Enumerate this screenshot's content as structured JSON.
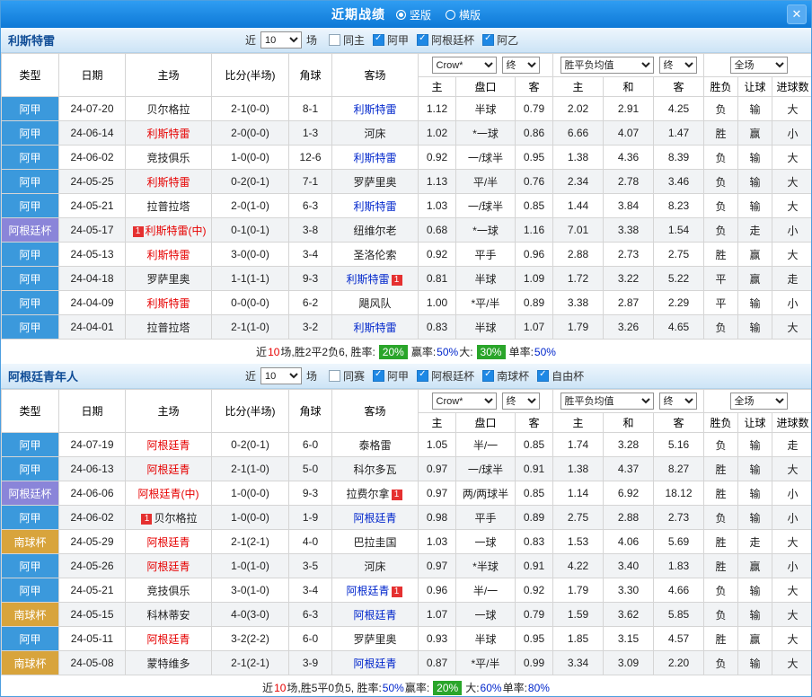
{
  "topbar": {
    "title": "近期战绩",
    "radios": [
      {
        "label": "竖版",
        "selected": true
      },
      {
        "label": "横版",
        "selected": false
      }
    ],
    "close_icon": "✕"
  },
  "header_labels": {
    "type": "类型",
    "date": "日期",
    "home": "主场",
    "score": "比分(半场)",
    "corner": "角球",
    "away": "客场",
    "odds_home": "主",
    "handicap": "盘口",
    "odds_away": "客",
    "eu_home": "主",
    "eu_draw": "和",
    "eu_away": "客",
    "result": "胜负",
    "handicap_result": "让球",
    "goals": "进球数",
    "bookmaker": "Crow*",
    "final": "终",
    "eu_avg": "胜平负均值",
    "scope": "全场",
    "recent_pre": "近",
    "recent_post": "场"
  },
  "red_card_badge": "1",
  "league_colors": {
    "阿甲": "#3b99dc",
    "阿根廷杯": "#8a85d9",
    "南球杯": "#d8a43c"
  },
  "value_colors": {
    "胜": "red",
    "平": "blue",
    "负": "green",
    "赢": "red",
    "走": "blue",
    "输": "green",
    "大": "red",
    "小": "green"
  },
  "accent_colors": {
    "win_red": "#e60000",
    "draw_blue": "#0026cc",
    "lose_green": "#009933",
    "badge_green": "#2aa52a",
    "bar_blue": "#1d8ae0"
  },
  "sections": [
    {
      "team": "利斯特雷",
      "recent_value": "10",
      "checkboxes": [
        {
          "label": "同主",
          "checked": false
        },
        {
          "label": "阿甲",
          "checked": true
        },
        {
          "label": "阿根廷杯",
          "checked": true
        },
        {
          "label": "阿乙",
          "checked": true
        }
      ],
      "rows": [
        {
          "lg": "阿甲",
          "dt": "24-07-20",
          "hm": "贝尔格拉",
          "hc": "blk",
          "hb": "",
          "sc": "2-1(0-0)",
          "scc": "red",
          "cn": "8-1",
          "aw": "利斯特雷",
          "ac": "blue",
          "ab": "",
          "o1": "1.12",
          "hd": "半球",
          "o2": "0.79",
          "e1": "2.02",
          "e2": "2.91",
          "e3": "4.25",
          "rs": "负",
          "hr": "输",
          "gl": "大"
        },
        {
          "lg": "阿甲",
          "dt": "24-06-14",
          "hm": "利斯特雷",
          "hc": "red",
          "hb": "",
          "sc": "2-0(0-0)",
          "scc": "red",
          "cn": "1-3",
          "aw": "河床",
          "ac": "blk",
          "ab": "",
          "o1": "1.02",
          "hd": "*一球",
          "o2": "0.86",
          "e1": "6.66",
          "e2": "4.07",
          "e3": "1.47",
          "rs": "胜",
          "hr": "赢",
          "gl": "小"
        },
        {
          "lg": "阿甲",
          "dt": "24-06-02",
          "hm": "竞技俱乐",
          "hc": "blk",
          "hb": "",
          "sc": "1-0(0-0)",
          "scc": "red",
          "cn": "12-6",
          "aw": "利斯特雷",
          "ac": "blue",
          "ab": "",
          "o1": "0.92",
          "hd": "一/球半",
          "o2": "0.95",
          "e1": "1.38",
          "e2": "4.36",
          "e3": "8.39",
          "rs": "负",
          "hr": "输",
          "gl": "大"
        },
        {
          "lg": "阿甲",
          "dt": "24-05-25",
          "hm": "利斯特雷",
          "hc": "red",
          "hb": "",
          "sc": "0-2(0-1)",
          "scc": "blue",
          "cn": "7-1",
          "aw": "罗萨里奥",
          "ac": "blk",
          "ab": "",
          "o1": "1.13",
          "hd": "平/半",
          "o2": "0.76",
          "e1": "2.34",
          "e2": "2.78",
          "e3": "3.46",
          "rs": "负",
          "hr": "输",
          "gl": "大"
        },
        {
          "lg": "阿甲",
          "dt": "24-05-21",
          "hm": "拉普拉塔",
          "hc": "blk",
          "hb": "",
          "sc": "2-0(1-0)",
          "scc": "red",
          "cn": "6-3",
          "aw": "利斯特雷",
          "ac": "blue",
          "ab": "",
          "o1": "1.03",
          "hd": "一/球半",
          "o2": "0.85",
          "e1": "1.44",
          "e2": "3.84",
          "e3": "8.23",
          "rs": "负",
          "hr": "输",
          "gl": "大"
        },
        {
          "lg": "阿根廷杯",
          "dt": "24-05-17",
          "hm": "利斯特雷(中)",
          "hc": "red",
          "hb": "pre",
          "sc": "0-1(0-1)",
          "scc": "blue",
          "cn": "3-8",
          "aw": "纽维尔老",
          "ac": "blk",
          "ab": "",
          "o1": "0.68",
          "hd": "*一球",
          "o2": "1.16",
          "e1": "7.01",
          "e2": "3.38",
          "e3": "1.54",
          "rs": "负",
          "hr": "走",
          "gl": "小"
        },
        {
          "lg": "阿甲",
          "dt": "24-05-13",
          "hm": "利斯特雷",
          "hc": "red",
          "hb": "",
          "sc": "3-0(0-0)",
          "scc": "red",
          "cn": "3-4",
          "aw": "圣洛伦索",
          "ac": "blk",
          "ab": "",
          "o1": "0.92",
          "hd": "平手",
          "o2": "0.96",
          "e1": "2.88",
          "e2": "2.73",
          "e3": "2.75",
          "rs": "胜",
          "hr": "赢",
          "gl": "大"
        },
        {
          "lg": "阿甲",
          "dt": "24-04-18",
          "hm": "罗萨里奥",
          "hc": "blk",
          "hb": "",
          "sc": "1-1(1-1)",
          "scc": "green",
          "cn": "9-3",
          "aw": "利斯特雷",
          "ac": "blue",
          "ab": "post",
          "o1": "0.81",
          "hd": "半球",
          "o2": "1.09",
          "e1": "1.72",
          "e2": "3.22",
          "e3": "5.22",
          "rs": "平",
          "hr": "赢",
          "gl": "走"
        },
        {
          "lg": "阿甲",
          "dt": "24-04-09",
          "hm": "利斯特雷",
          "hc": "red",
          "hb": "",
          "sc": "0-0(0-0)",
          "scc": "green",
          "cn": "6-2",
          "aw": "飓风队",
          "ac": "blk",
          "ab": "",
          "o1": "1.00",
          "hd": "*平/半",
          "o2": "0.89",
          "e1": "3.38",
          "e2": "2.87",
          "e3": "2.29",
          "rs": "平",
          "hr": "输",
          "gl": "小"
        },
        {
          "lg": "阿甲",
          "dt": "24-04-01",
          "hm": "拉普拉塔",
          "hc": "blk",
          "hb": "",
          "sc": "2-1(1-0)",
          "scc": "red",
          "cn": "3-2",
          "aw": "利斯特雷",
          "ac": "blue",
          "ab": "",
          "o1": "0.83",
          "hd": "半球",
          "o2": "1.07",
          "e1": "1.79",
          "e2": "3.26",
          "e3": "4.65",
          "rs": "负",
          "hr": "输",
          "gl": "大"
        }
      ],
      "summary": [
        {
          "t": "近",
          "s": ""
        },
        {
          "t": "10",
          "s": "red"
        },
        {
          "t": "场,胜2平2负6, 胜率:",
          "s": ""
        },
        {
          "t": "20%",
          "s": "badge"
        },
        {
          "t": " 赢率:",
          "s": ""
        },
        {
          "t": "50%",
          "s": "blue"
        },
        {
          "t": " 大:",
          "s": ""
        },
        {
          "t": "30%",
          "s": "badge"
        },
        {
          "t": " 单率:",
          "s": ""
        },
        {
          "t": "50%",
          "s": "blue"
        }
      ]
    },
    {
      "team": "阿根廷青年人",
      "recent_value": "10",
      "checkboxes": [
        {
          "label": "同赛",
          "checked": false
        },
        {
          "label": "阿甲",
          "checked": true
        },
        {
          "label": "阿根廷杯",
          "checked": true
        },
        {
          "label": "南球杯",
          "checked": true
        },
        {
          "label": "自由杯",
          "checked": true
        }
      ],
      "rows": [
        {
          "lg": "阿甲",
          "dt": "24-07-19",
          "hm": "阿根廷青",
          "hc": "red",
          "hb": "",
          "sc": "0-2(0-1)",
          "scc": "blue",
          "cn": "6-0",
          "aw": "泰格雷",
          "ac": "blk",
          "ab": "",
          "o1": "1.05",
          "hd": "半/一",
          "o2": "0.85",
          "e1": "1.74",
          "e2": "3.28",
          "e3": "5.16",
          "rs": "负",
          "hr": "输",
          "gl": "走"
        },
        {
          "lg": "阿甲",
          "dt": "24-06-13",
          "hm": "阿根廷青",
          "hc": "red",
          "hb": "",
          "sc": "2-1(1-0)",
          "scc": "red",
          "cn": "5-0",
          "aw": "科尔多瓦",
          "ac": "blk",
          "ab": "",
          "o1": "0.97",
          "hd": "一/球半",
          "o2": "0.91",
          "e1": "1.38",
          "e2": "4.37",
          "e3": "8.27",
          "rs": "胜",
          "hr": "输",
          "gl": "大"
        },
        {
          "lg": "阿根廷杯",
          "dt": "24-06-06",
          "hm": "阿根廷青(中)",
          "hc": "red",
          "hb": "",
          "sc": "1-0(0-0)",
          "scc": "red",
          "cn": "9-3",
          "aw": "拉费尔拿",
          "ac": "blk",
          "ab": "post",
          "o1": "0.97",
          "hd": "两/两球半",
          "o2": "0.85",
          "e1": "1.14",
          "e2": "6.92",
          "e3": "18.12",
          "rs": "胜",
          "hr": "输",
          "gl": "小"
        },
        {
          "lg": "阿甲",
          "dt": "24-06-02",
          "hm": "贝尔格拉",
          "hc": "blk",
          "hb": "pre",
          "sc": "1-0(0-0)",
          "scc": "red",
          "cn": "1-9",
          "aw": "阿根廷青",
          "ac": "blue",
          "ab": "",
          "o1": "0.98",
          "hd": "平手",
          "o2": "0.89",
          "e1": "2.75",
          "e2": "2.88",
          "e3": "2.73",
          "rs": "负",
          "hr": "输",
          "gl": "小"
        },
        {
          "lg": "南球杯",
          "dt": "24-05-29",
          "hm": "阿根廷青",
          "hc": "red",
          "hb": "",
          "sc": "2-1(2-1)",
          "scc": "red",
          "cn": "4-0",
          "aw": "巴拉圭国",
          "ac": "blk",
          "ab": "",
          "o1": "1.03",
          "hd": "一球",
          "o2": "0.83",
          "e1": "1.53",
          "e2": "4.06",
          "e3": "5.69",
          "rs": "胜",
          "hr": "走",
          "gl": "大"
        },
        {
          "lg": "阿甲",
          "dt": "24-05-26",
          "hm": "阿根廷青",
          "hc": "red",
          "hb": "",
          "sc": "1-0(1-0)",
          "scc": "red",
          "cn": "3-5",
          "aw": "河床",
          "ac": "blk",
          "ab": "",
          "o1": "0.97",
          "hd": "*半球",
          "o2": "0.91",
          "e1": "4.22",
          "e2": "3.40",
          "e3": "1.83",
          "rs": "胜",
          "hr": "赢",
          "gl": "小"
        },
        {
          "lg": "阿甲",
          "dt": "24-05-21",
          "hm": "竞技俱乐",
          "hc": "blk",
          "hb": "",
          "sc": "3-0(1-0)",
          "scc": "red",
          "cn": "3-4",
          "aw": "阿根廷青",
          "ac": "blue",
          "ab": "post",
          "o1": "0.96",
          "hd": "半/一",
          "o2": "0.92",
          "e1": "1.79",
          "e2": "3.30",
          "e3": "4.66",
          "rs": "负",
          "hr": "输",
          "gl": "大"
        },
        {
          "lg": "南球杯",
          "dt": "24-05-15",
          "hm": "科林蒂安",
          "hc": "blk",
          "hb": "",
          "sc": "4-0(3-0)",
          "scc": "red",
          "cn": "6-3",
          "aw": "阿根廷青",
          "ac": "blue",
          "ab": "",
          "o1": "1.07",
          "hd": "一球",
          "o2": "0.79",
          "e1": "1.59",
          "e2": "3.62",
          "e3": "5.85",
          "rs": "负",
          "hr": "输",
          "gl": "大"
        },
        {
          "lg": "阿甲",
          "dt": "24-05-11",
          "hm": "阿根廷青",
          "hc": "red",
          "hb": "",
          "sc": "3-2(2-2)",
          "scc": "red",
          "cn": "6-0",
          "aw": "罗萨里奥",
          "ac": "blk",
          "ab": "",
          "o1": "0.93",
          "hd": "半球",
          "o2": "0.95",
          "e1": "1.85",
          "e2": "3.15",
          "e3": "4.57",
          "rs": "胜",
          "hr": "赢",
          "gl": "大"
        },
        {
          "lg": "南球杯",
          "dt": "24-05-08",
          "hm": "蒙特维多",
          "hc": "blk",
          "hb": "",
          "sc": "2-1(2-1)",
          "scc": "red",
          "cn": "3-9",
          "aw": "阿根廷青",
          "ac": "blue",
          "ab": "",
          "o1": "0.87",
          "hd": "*平/半",
          "o2": "0.99",
          "e1": "3.34",
          "e2": "3.09",
          "e3": "2.20",
          "rs": "负",
          "hr": "输",
          "gl": "大"
        }
      ],
      "summary": [
        {
          "t": "近",
          "s": ""
        },
        {
          "t": "10",
          "s": "red"
        },
        {
          "t": "场,胜5平0负5, 胜率:",
          "s": ""
        },
        {
          "t": "50%",
          "s": "blue"
        },
        {
          "t": " 赢率:",
          "s": ""
        },
        {
          "t": "20%",
          "s": "badge"
        },
        {
          "t": " 大:",
          "s": ""
        },
        {
          "t": "60%",
          "s": "blue"
        },
        {
          "t": " 单率:",
          "s": ""
        },
        {
          "t": "80%",
          "s": "blue"
        }
      ]
    }
  ]
}
